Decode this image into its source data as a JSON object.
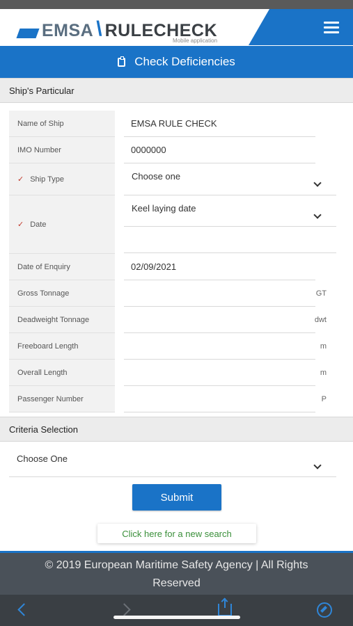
{
  "header": {
    "logo_emsa": "EMSA",
    "logo_rulecheck": "RULECHECK",
    "logo_subtitle": "Mobile application"
  },
  "title": "Check Deficiencies",
  "ship_particular": {
    "heading": "Ship's Particular",
    "name_label": "Name of Ship",
    "name_value": "EMSA RULE CHECK",
    "imo_label": "IMO Number",
    "imo_value": "0000000",
    "ship_type_label": "Ship Type",
    "ship_type_value": "Choose one",
    "date_label": "Date",
    "date_value": "Keel laying date",
    "enquiry_label": "Date of Enquiry",
    "enquiry_value": "02/09/2021",
    "gross_label": "Gross Tonnage",
    "gross_unit": "GT",
    "deadweight_label": "Deadweight Tonnage",
    "deadweight_unit": "dwt",
    "freeboard_label": "Freeboard Length",
    "freeboard_unit": "m",
    "overall_label": "Overall Length",
    "overall_unit": "m",
    "passenger_label": "Passenger Number",
    "passenger_unit": "P"
  },
  "criteria": {
    "heading": "Criteria Selection",
    "value": "Choose One"
  },
  "buttons": {
    "submit": "Submit",
    "new_search": "Click here for a new search"
  },
  "footer": {
    "line1": "© 2019 European Maritime Safety Agency | All Rights",
    "line2": "Reserved"
  },
  "colors": {
    "accent": "#1a73c7",
    "footer_bg": "#4a5159",
    "link_green": "#3a8f3a",
    "required_check": "#c0392b"
  }
}
